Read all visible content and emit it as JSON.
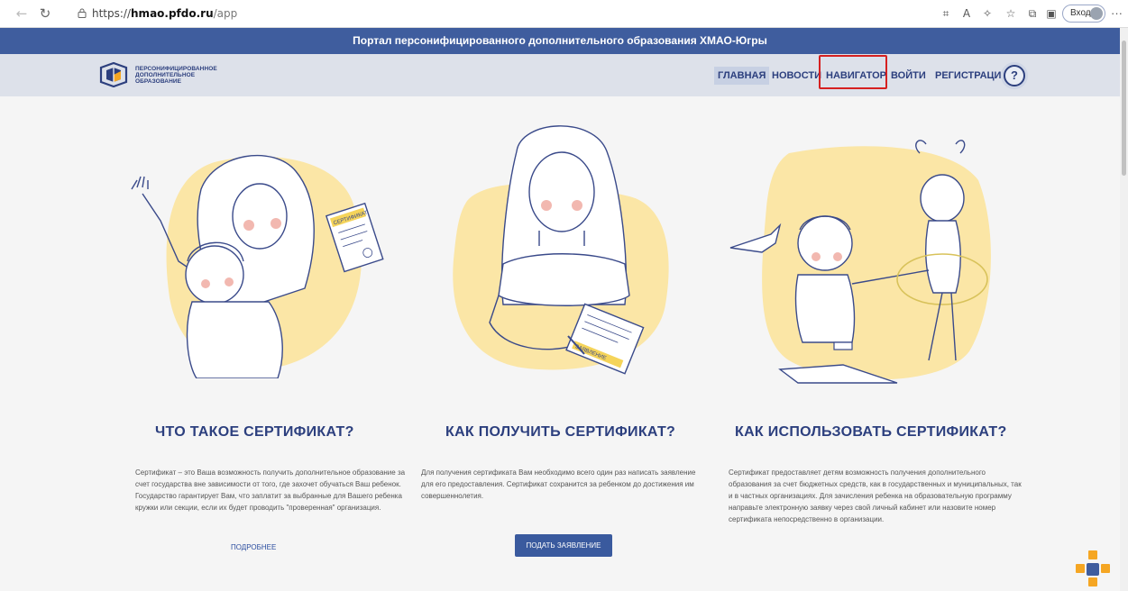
{
  "browser": {
    "url_scheme": "https://",
    "url_host": "hmao.pfdo.ru",
    "url_path": "/app",
    "login_label": "Вход"
  },
  "site": {
    "top_banner": "Портал персонифицированного дополнительного образования ХМАО-Югры",
    "logo_lines": [
      "ПЕРСОНИФИЦИРОВАННОЕ",
      "ДОПОЛНИТЕЛЬНОЕ",
      "ОБРАЗОВАНИЕ"
    ],
    "menu": {
      "home": "ГЛАВНАЯ",
      "news": "НОВОСТИ",
      "navigator": "НАВИГАТОР",
      "login": "ВОЙТИ",
      "register": "РЕГИСТРАЦИЯ",
      "help": "?"
    }
  },
  "columns": [
    {
      "title": "ЧТО ТАКОЕ СЕРТИФИКАТ?",
      "text": "Сертификат – это Ваша возможность получить дополнительное образование за счет государства вне зависимости от того, где захочет обучаться Ваш ребенок. Государство гарантирует Вам, что заплатит за выбранные для Вашего ребенка кружки или секции, если их будет проводить \"проверенная\" организация.",
      "link": "ПОДРОБНЕЕ",
      "illustration_label": "СЕРТИФИКАТ"
    },
    {
      "title": "КАК ПОЛУЧИТЬ СЕРТИФИКАТ?",
      "text": "Для получения сертификата Вам необходимо всего один раз написать заявление для его предоставления. Сертификат сохранится за ребенком до достижения им совершеннолетия.",
      "button": "ПОДАТЬ ЗАЯВЛЕНИЕ",
      "illustration_label": "ЗАЯВЛЕНИЕ"
    },
    {
      "title": "КАК ИСПОЛЬЗОВАТЬ СЕРТИФИКАТ?",
      "text": "Сертификат предоставляет детям возможность получения дополнительного образования за счет бюджетных средств, как в государственных и муниципальных, так и в частных организациях. Для зачисления ребенка на образовательную программу направьте электронную заявку через свой личный кабинет или назовите номер сертификата непосредственно в организации."
    }
  ],
  "colors": {
    "brand_blue": "#3f5d9e",
    "title_blue": "#2c3f7e",
    "illustration_yellow": "#fbe6a6",
    "highlight_red": "#d62020"
  }
}
